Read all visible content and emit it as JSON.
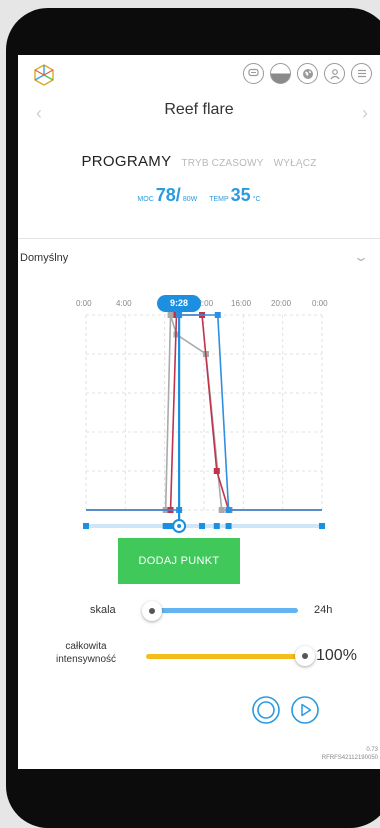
{
  "header": {
    "device_name": "Reef flare",
    "icons": [
      "logo-cube-icon",
      "chat-icon",
      "half-circle-icon",
      "globe-icon",
      "user-icon",
      "menu-icon"
    ]
  },
  "tabs": [
    {
      "label": "PROGRAMY",
      "active": true
    },
    {
      "label": "TRYB CZASOWY",
      "active": false
    },
    {
      "label": "WYŁĄCZ",
      "active": false
    }
  ],
  "readouts": {
    "power_label": "MOC",
    "power_value": "78",
    "power_sep": "/",
    "power_max": "80W",
    "temp_label": "TEMP",
    "temp_value": "35",
    "temp_unit": "°C"
  },
  "preset": {
    "selected": "Domyślny"
  },
  "timeline": {
    "labels": [
      "0:00",
      "4:00",
      "12:00",
      "16:00",
      "20:00",
      "0:00"
    ],
    "current_time": "9:28"
  },
  "chart_data": {
    "type": "line",
    "x_unit": "hours",
    "xlim": [
      0,
      24
    ],
    "ylim": [
      0,
      100
    ],
    "current_time_hours": 9.47,
    "series": [
      {
        "color": "#aaaaaa",
        "points": [
          [
            0,
            0
          ],
          [
            8.1,
            0
          ],
          [
            8.6,
            100
          ],
          [
            9.2,
            90
          ],
          [
            12.2,
            80
          ],
          [
            13.8,
            0
          ],
          [
            14.6,
            0
          ],
          [
            24,
            0
          ]
        ]
      },
      {
        "color": "#c0334d",
        "points": [
          [
            0,
            0
          ],
          [
            8.6,
            0
          ],
          [
            9.2,
            100
          ],
          [
            11.8,
            100
          ],
          [
            13.3,
            20
          ],
          [
            14.5,
            0
          ],
          [
            24,
            0
          ]
        ]
      },
      {
        "color": "#2f8fe0",
        "points": [
          [
            0,
            0
          ],
          [
            9.47,
            0
          ],
          [
            9.47,
            100
          ],
          [
            13.4,
            100
          ],
          [
            14.5,
            0
          ],
          [
            24,
            0
          ]
        ]
      }
    ],
    "handles_x": [
      0,
      8.1,
      8.6,
      9.47,
      11.8,
      13.3,
      14.5,
      24
    ]
  },
  "actions": {
    "add_point": "DODAJ PUNKT"
  },
  "scale": {
    "label": "skala",
    "value": "24h",
    "position": 0.0
  },
  "intensity": {
    "label": "całkowita intensywność",
    "value": "100%",
    "level": 1.0
  },
  "controls": [
    "stop-circle-icon",
    "play-icon"
  ],
  "footer": {
    "version": "0.73",
    "serial": "RFRFS42112190050"
  },
  "colors": {
    "accent": "#1d8fe0",
    "button": "#41c85b",
    "intensity": "#f3bd1d",
    "scale": "#63b4f0"
  }
}
